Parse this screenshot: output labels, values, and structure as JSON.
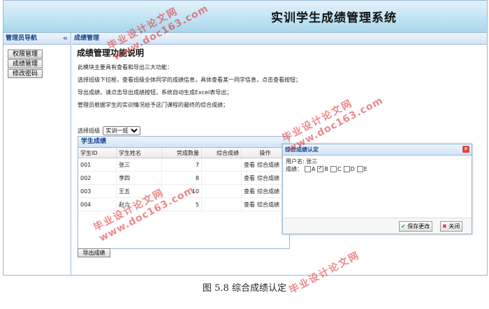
{
  "app": {
    "title": "实训学生成绩管理系统"
  },
  "sidebar": {
    "title": "管理员导航",
    "collapse_glyph": "«",
    "items": [
      {
        "label": "权限管理"
      },
      {
        "label": "成绩管理"
      },
      {
        "label": "修改密码"
      }
    ]
  },
  "main": {
    "panel_title": "成绩管理",
    "heading": "成绩管理功能说明",
    "paragraphs": [
      "此模块主要具有查看和导出三大功能：",
      "选择班级下拉框，查看班级全体同学的成绩信息，具体查看某一同学信息，点击查看按钮；",
      "导出成绩，请点击导出成绩按钮，系统自动生成Excel表导出；",
      "管理员根据学生的实训情况给予这门课程的最终的综合成绩；"
    ],
    "class_label": "选择班级",
    "class_selected": "实训一班"
  },
  "grid": {
    "title": "学生成绩",
    "columns": [
      "学生ID",
      "学生姓名",
      "完成数量",
      "综合成绩",
      "操作"
    ],
    "rows": [
      {
        "id": "001",
        "name": "张三",
        "count": "7",
        "score": "",
        "view": "查看",
        "grade": "综合成绩"
      },
      {
        "id": "002",
        "name": "李四",
        "count": "8",
        "score": "",
        "view": "查看",
        "grade": "综合成绩"
      },
      {
        "id": "003",
        "name": "王五",
        "count": "10",
        "score": "",
        "view": "查看",
        "grade": "综合成绩"
      },
      {
        "id": "004",
        "name": "赵六",
        "count": "5",
        "score": "",
        "view": "查看",
        "grade": "综合成绩"
      }
    ],
    "export_label": "导出成绩"
  },
  "dialog": {
    "title": "综合成绩认定",
    "username_label": "用户名:",
    "username": "张三",
    "grade_label": "成绩：",
    "options": [
      {
        "label": "A",
        "checked": false
      },
      {
        "label": "B",
        "checked": true
      },
      {
        "label": "C",
        "checked": false
      },
      {
        "label": "D",
        "checked": false
      },
      {
        "label": "E",
        "checked": false
      }
    ],
    "save_label": "保存更改",
    "close_label": "关闭"
  },
  "caption": "图 5.8  综合成绩认定",
  "watermark": {
    "line1": "毕业设计论文网",
    "line2": "www.doc163.com"
  }
}
